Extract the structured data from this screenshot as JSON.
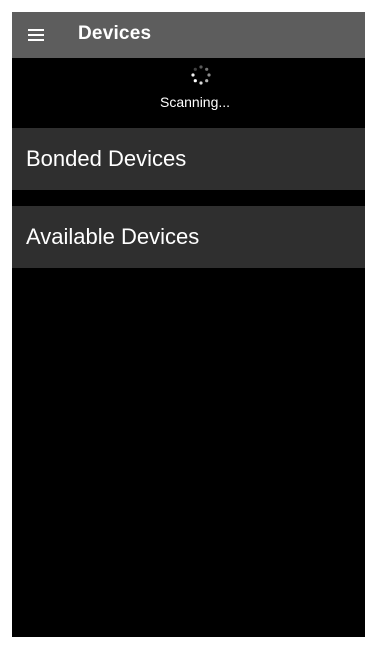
{
  "app_bar": {
    "title": "Devices",
    "menu_icon": "hamburger-menu-icon"
  },
  "scan": {
    "status_text": "Scanning...",
    "spinner_icon": "loading-spinner-icon"
  },
  "sections": {
    "bonded_label": "Bonded Devices",
    "available_label": "Available Devices"
  },
  "colors": {
    "app_bar_bg": "#5d5d5d",
    "screen_bg": "#000000",
    "section_bg": "#2f2f2f",
    "text": "#ffffff"
  }
}
